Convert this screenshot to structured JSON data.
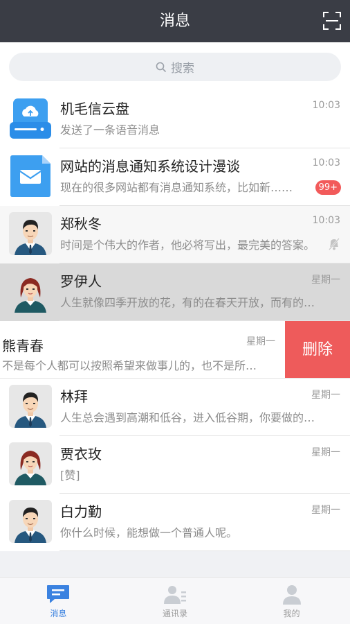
{
  "header": {
    "title": "消息"
  },
  "search": {
    "placeholder": "搜索"
  },
  "conversations": [
    {
      "name": "机毛信云盘",
      "preview": "发送了一条语音消息",
      "time": "10:03"
    },
    {
      "name": "网站的消息通知系统设计漫谈",
      "preview": "现在的很多网站都有消息通知系统，比如新……",
      "time": "10:03",
      "badge": "99+"
    },
    {
      "name": "郑秋冬",
      "preview": "时间是个伟大的作者，他必将写出，最完美的答案。",
      "time": "10:03"
    },
    {
      "name": "罗伊人",
      "preview": "人生就像四季开放的花，有的在春天开放，而有的却…",
      "time": "星期一"
    },
    {
      "name": "熊青春",
      "preview": "不是每个人都可以按照希望来做事儿的，也不是所…",
      "time": "星期一",
      "action": "删除"
    },
    {
      "name": "林拜",
      "preview": "人生总会遇到高潮和低谷，进入低谷期，你要做的…",
      "time": "星期一"
    },
    {
      "name": "贾衣玫",
      "preview": "[赞]",
      "time": "星期一"
    },
    {
      "name": "白力勤",
      "preview": "你什么时候，能想做一个普通人呢。",
      "time": "星期一"
    }
  ],
  "tabbar": [
    {
      "label": "消息",
      "icon": "chat-icon",
      "active": true
    },
    {
      "label": "通讯录",
      "icon": "contacts-icon"
    },
    {
      "label": "我的",
      "icon": "profile-icon"
    }
  ],
  "colors": {
    "nav": "#3a3d45",
    "accent": "#3b82e0",
    "badge": "#f25a5a",
    "delete": "#ee5b5b"
  }
}
